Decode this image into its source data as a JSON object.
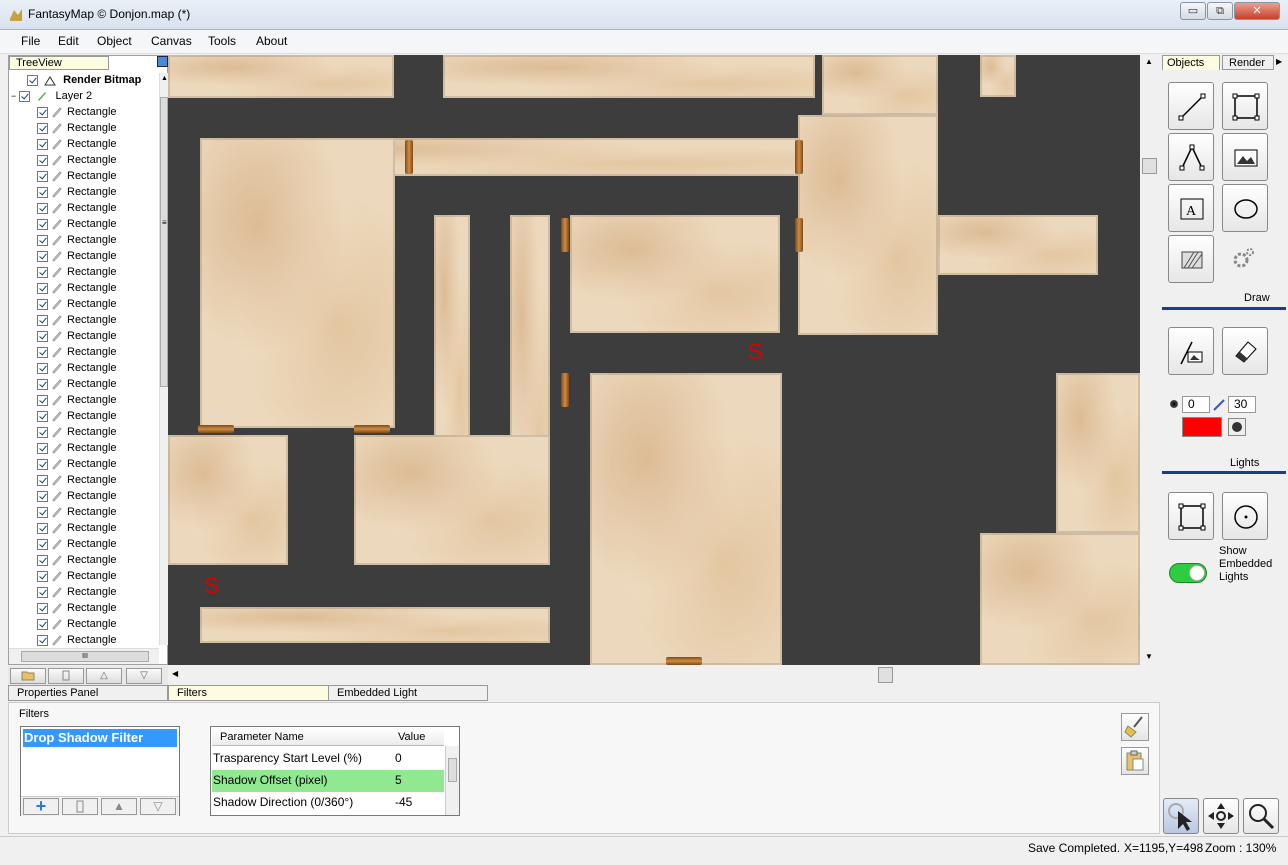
{
  "window": {
    "title": "FantasyMap © Donjon.map (*)",
    "minimize": "▭",
    "restore": "⧉",
    "close": "✕"
  },
  "menu": [
    "File",
    "Edit",
    "Object",
    "Canvas",
    "Tools",
    "About"
  ],
  "tree": {
    "tab": "TreeView",
    "render_bitmap": "Render Bitmap",
    "layer": "Layer 2",
    "item_label": "Rectangle",
    "item_count": 34,
    "hscroll_mark": "III",
    "scroll_mark": "≡"
  },
  "canvas": {
    "secret_mark": "S"
  },
  "right_panel": {
    "tabs": [
      "Objects",
      "Render"
    ],
    "draw_label": "Draw",
    "lights_label": "Lights",
    "light_min": "0",
    "light_max": "30",
    "light_color": "#ff0000",
    "show_embedded_label": "Show Embedded Lights",
    "show_embedded_on": true
  },
  "bottom_tabs": [
    "Properties Panel",
    "Filters",
    "Embedded Light"
  ],
  "filters": {
    "group_label": "Filters",
    "list": [
      "Drop Shadow Filter"
    ],
    "grid_headers": [
      "Parameter Name",
      "Value"
    ],
    "rows": [
      {
        "name": "Trasparency Start Level (%)",
        "value": "0",
        "selected": false
      },
      {
        "name": "Shadow Offset (pixel)",
        "value": "5",
        "selected": true
      },
      {
        "name": "Shadow Direction (0/360°)",
        "value": "-45",
        "selected": false
      }
    ],
    "add": "+"
  },
  "status": {
    "message": "Save Completed.",
    "coords": "X=1195,Y=498",
    "zoom": "Zoom : 130%"
  }
}
